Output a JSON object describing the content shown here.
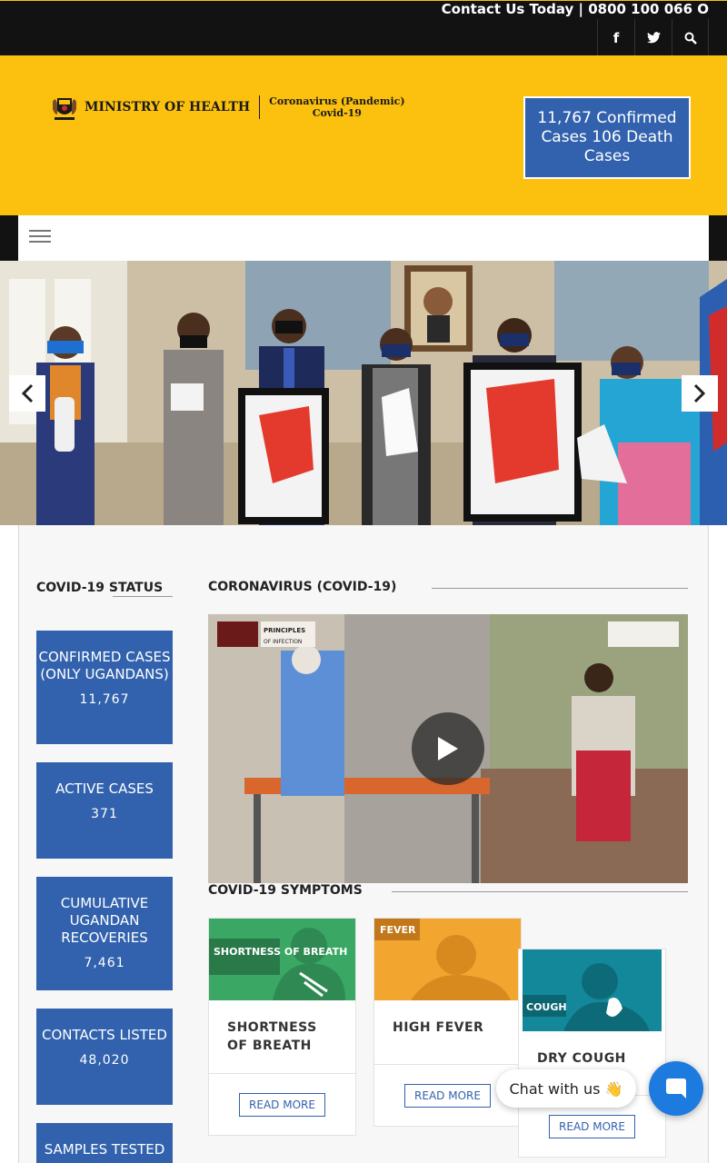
{
  "topbar": {
    "contact_text": "Contact Us Today | 0800 100 066 O",
    "social": [
      "facebook-icon",
      "twitter-icon",
      "search-icon"
    ]
  },
  "header": {
    "ministry_name": "MINISTRY OF HEALTH",
    "sub_line1": "Coronavirus (Pandemic)",
    "sub_line2": "Covid-19",
    "cases_box_text": "11,767 Confirmed Cases 106 Death Cases",
    "brand_yellow": "#fcc00e",
    "accent_blue": "#3262ad"
  },
  "nav": {
    "menu_icon": "hamburger-menu-icon"
  },
  "slider": {
    "prev_icon": "chevron-left-icon",
    "next_icon": "chevron-right-icon"
  },
  "sidebar": {
    "title": "COVID-19 STATUS",
    "stats": [
      {
        "label": "CONFIRMED CASES (ONLY UGANDANS)",
        "value": "11,767"
      },
      {
        "label": "ACTIVE CASES",
        "value": "371"
      },
      {
        "label": "CUMULATIVE UGANDAN RECOVERIES",
        "value": "7,461"
      },
      {
        "label": "CONTACTS LISTED",
        "value": "48,020"
      },
      {
        "label": "SAMPLES TESTED",
        "value": ""
      }
    ]
  },
  "main": {
    "title": "CORONAVIRUS (COVID-19)",
    "video_caption_1": "PRINCIPLES OF INFECTION PREVENTION",
    "symptoms_title": "COVID-19 SYMPTOMS",
    "cards": [
      {
        "image_label": "SHORTNESS OF BREATH",
        "title": "SHORTNESS OF BREATH",
        "button": "READ MORE"
      },
      {
        "image_label": "FEVER",
        "title": "HIGH FEVER",
        "button": "READ MORE"
      },
      {
        "image_label": "COUGH",
        "title": "DRY COUGH",
        "button": "READ MORE"
      }
    ]
  },
  "chat": {
    "pill_text": "Chat with us 👋"
  }
}
